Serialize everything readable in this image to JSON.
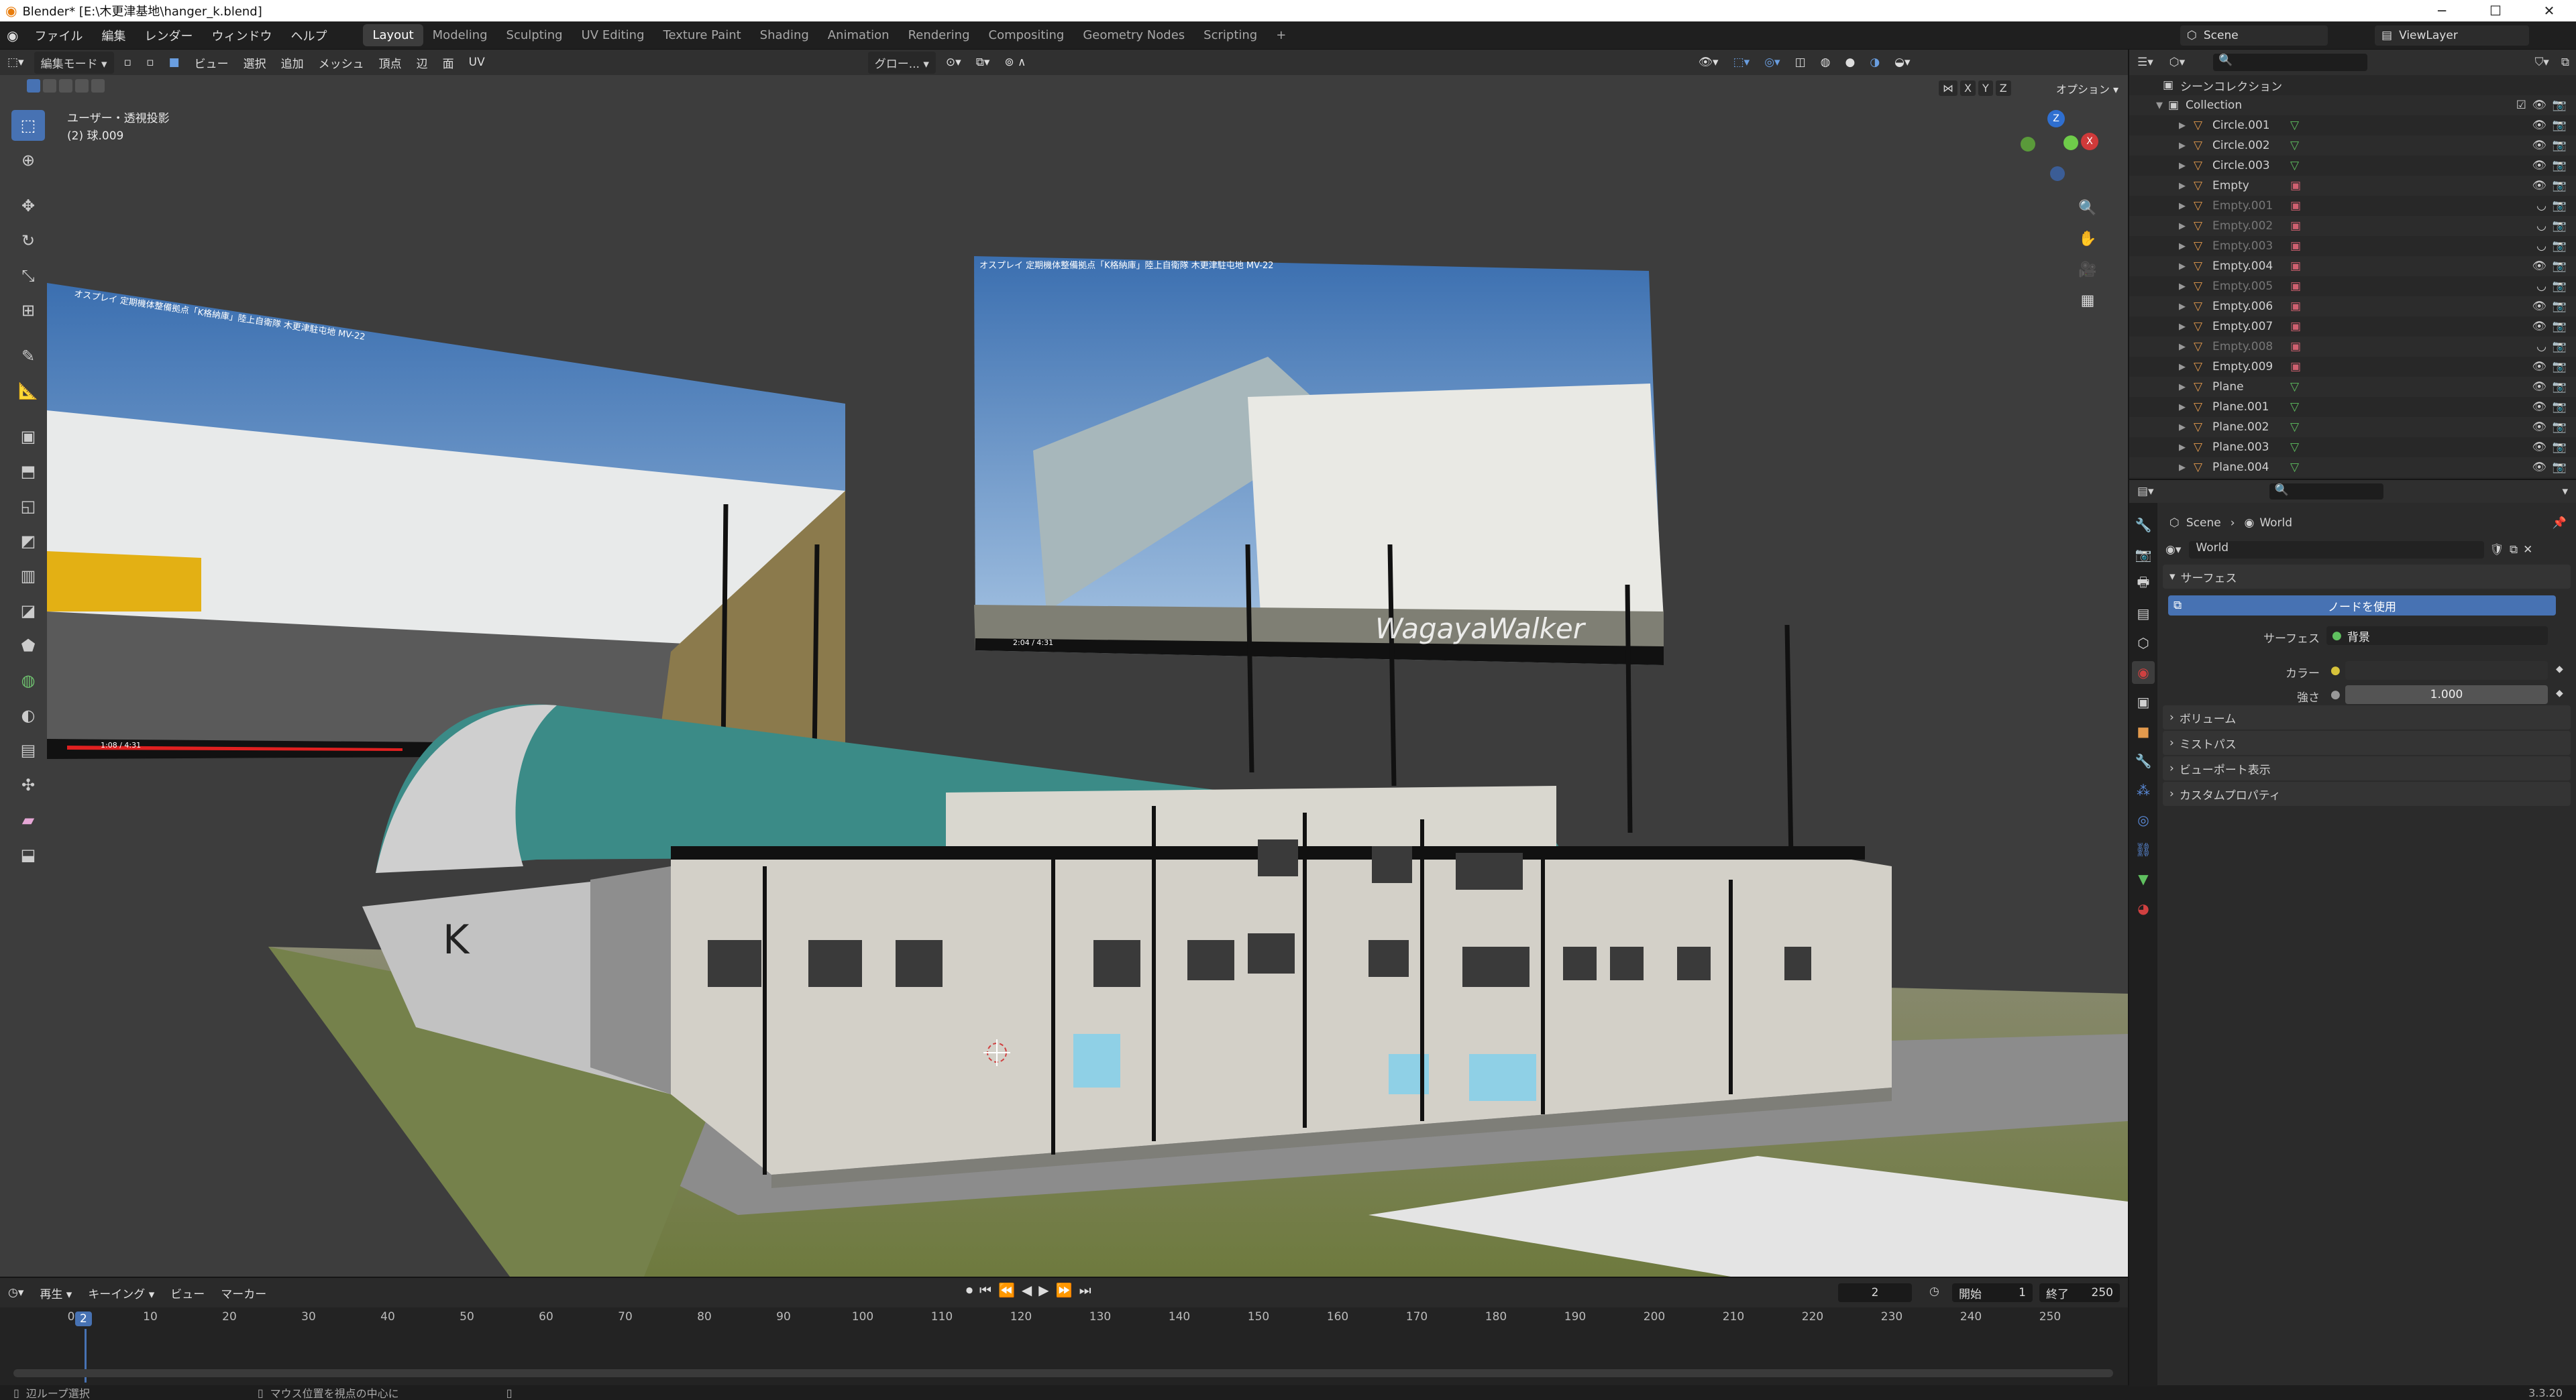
{
  "window": {
    "title": "Blender* [E:\\木更津基地\\hanger_k.blend]",
    "controls": [
      "─",
      "☐",
      "✕"
    ]
  },
  "menu": [
    "ファイル",
    "編集",
    "レンダー",
    "ウィンドウ",
    "ヘルプ"
  ],
  "workspaces": [
    "Layout",
    "Modeling",
    "Sculpting",
    "UV Editing",
    "Texture Paint",
    "Shading",
    "Animation",
    "Rendering",
    "Compositing",
    "Geometry Nodes",
    "Scripting",
    "+"
  ],
  "active_workspace": "Layout",
  "scene_selector": "Scene",
  "viewlayer_selector": "ViewLayer",
  "viewport": {
    "mode": "編集モード",
    "menus": [
      "ビュー",
      "選択",
      "追加",
      "メッシュ",
      "頂点",
      "辺",
      "面",
      "UV"
    ],
    "transform_orientation": "グロー...",
    "info_line1": "ユーザー・透視投影",
    "info_line2": "(2) 球.009",
    "options_label": "オプション",
    "axis_labels": [
      "X",
      "Y",
      "Z"
    ],
    "overlay_left": "オスプレイ 定期機体整備拠点「K格納庫」陸上自衛隊 木更津駐屯地 MV-22",
    "overlay_right": "オスプレイ 定期機体整備拠点「K格納庫」陸上自衛隊 木更津駐屯地 MV-22",
    "watermark": "WagayaWalker",
    "video_time_left": "1:08 / 4:31",
    "video_time_right": "2:04 / 4:31",
    "building_letter": "K"
  },
  "timeline": {
    "menus": [
      "再生",
      "キーイング",
      "ビュー",
      "マーカー"
    ],
    "current_frame": "2",
    "start_label": "開始",
    "start": "1",
    "end_label": "終了",
    "end": "250",
    "ruler": [
      "0",
      "10",
      "20",
      "30",
      "40",
      "50",
      "60",
      "70",
      "80",
      "90",
      "100",
      "110",
      "120",
      "130",
      "140",
      "150",
      "160",
      "170",
      "180",
      "190",
      "200",
      "210",
      "220",
      "230",
      "240",
      "250"
    ]
  },
  "status": {
    "left": "辺ループ選択",
    "middle": "マウス位置を視点の中心に",
    "version": "3.3.20"
  },
  "outliner": {
    "scene_collection": "シーンコレクション",
    "collection": "Collection",
    "items": [
      {
        "name": "Circle.001",
        "type": "mesh",
        "dim": false
      },
      {
        "name": "Circle.002",
        "type": "mesh",
        "dim": false
      },
      {
        "name": "Circle.003",
        "type": "mesh",
        "dim": false
      },
      {
        "name": "Empty",
        "type": "image",
        "dim": false
      },
      {
        "name": "Empty.001",
        "type": "image",
        "dim": true
      },
      {
        "name": "Empty.002",
        "type": "image",
        "dim": true
      },
      {
        "name": "Empty.003",
        "type": "image",
        "dim": true
      },
      {
        "name": "Empty.004",
        "type": "image",
        "dim": false
      },
      {
        "name": "Empty.005",
        "type": "image",
        "dim": true
      },
      {
        "name": "Empty.006",
        "type": "image",
        "dim": false
      },
      {
        "name": "Empty.007",
        "type": "image",
        "dim": false
      },
      {
        "name": "Empty.008",
        "type": "image",
        "dim": true
      },
      {
        "name": "Empty.009",
        "type": "image",
        "dim": false
      },
      {
        "name": "Plane",
        "type": "mesh",
        "dim": false
      },
      {
        "name": "Plane.001",
        "type": "mesh",
        "dim": false
      },
      {
        "name": "Plane.002",
        "type": "mesh",
        "dim": false
      },
      {
        "name": "Plane.003",
        "type": "mesh",
        "dim": false
      },
      {
        "name": "Plane.004",
        "type": "mesh",
        "dim": false
      }
    ]
  },
  "properties": {
    "breadcrumb_scene": "Scene",
    "breadcrumb_world": "World",
    "world_name": "World",
    "surface_panel": "サーフェス",
    "use_nodes": "ノードを使用",
    "surface_label": "サーフェス",
    "surface_value": "背景",
    "color_label": "カラー",
    "strength_label": "強さ",
    "strength_value": "1.000",
    "panels": [
      "ボリューム",
      "ミストパス",
      "ビューポート表示",
      "カスタムプロパティ"
    ]
  }
}
